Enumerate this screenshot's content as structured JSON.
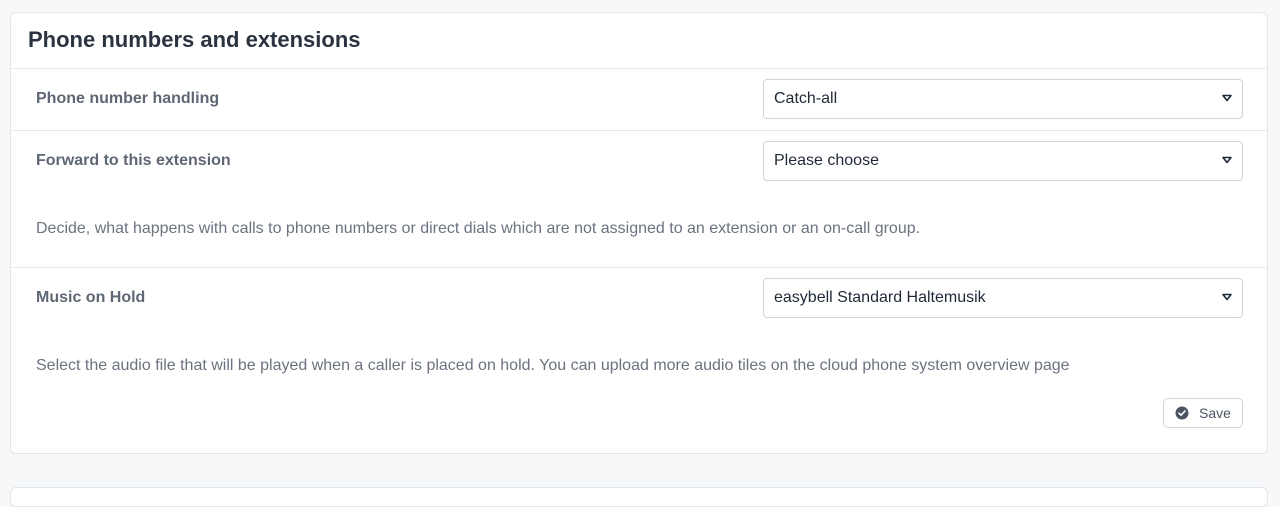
{
  "card": {
    "title": "Phone numbers and extensions",
    "rows": [
      {
        "label": "Phone number handling",
        "value": "Catch-all"
      },
      {
        "label": "Forward to this extension",
        "value": "Please choose"
      },
      {
        "label": "Music on Hold",
        "value": "easybell Standard Haltemusik"
      }
    ],
    "forward_description": "Decide, what happens with calls to phone numbers or direct dials which are not assigned to an extension or an on-call group.",
    "moh_description": "Select the audio file that will be played when a caller is placed on hold. You can upload more audio tiles on the cloud phone system overview page",
    "save_label": "Save"
  },
  "colors": {
    "icon": "#4b5563",
    "border": "#cfd4da"
  },
  "icons": {
    "select_chevron": "chevron-down-icon",
    "save": "check-circle-icon"
  }
}
